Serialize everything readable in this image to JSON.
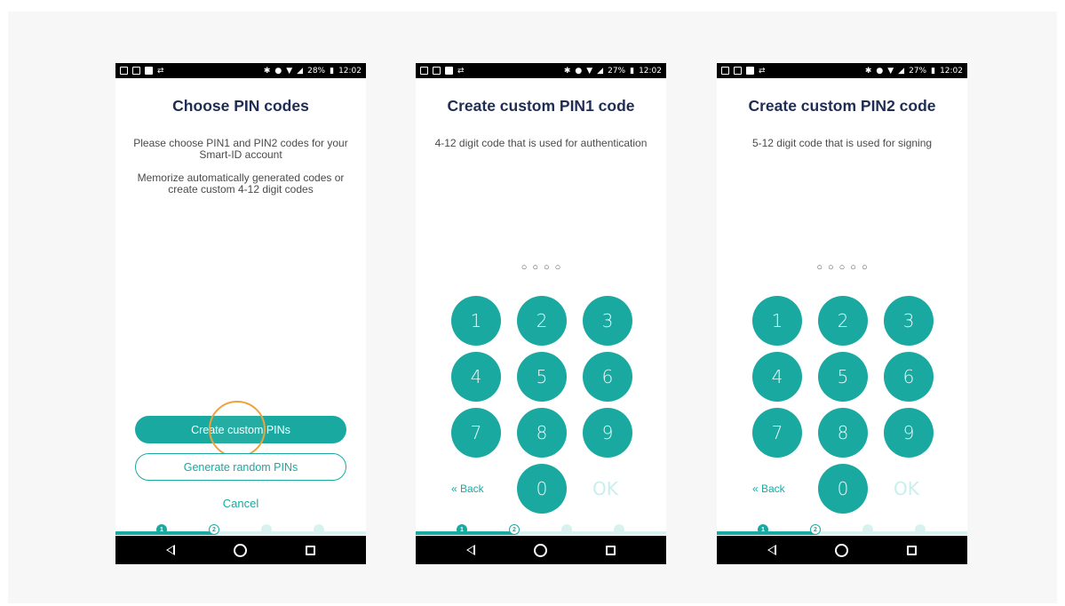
{
  "status": {
    "screen1": {
      "battery": "28%",
      "time": "12:02"
    },
    "screen2": {
      "battery": "27%",
      "time": "12:02"
    },
    "screen3": {
      "battery": "27%",
      "time": "12:02"
    }
  },
  "screen1": {
    "title": "Choose PIN codes",
    "para1": "Please choose PIN1 and PIN2 codes for your Smart-ID account",
    "para2": "Memorize automatically generated codes or create custom 4-12 digit codes",
    "create_button": "Create custom PINs",
    "generate_button": "Generate random PINs",
    "cancel": "Cancel"
  },
  "screen2": {
    "title": "Create custom PIN1 code",
    "description": "4-12 digit code that is used for authentication",
    "pin_dots": "○○○○"
  },
  "screen3": {
    "title": "Create custom PIN2 code",
    "description": "5-12 digit code that is used for signing",
    "pin_dots": "○○○○○"
  },
  "keypad": {
    "keys": [
      "1",
      "2",
      "3",
      "4",
      "5",
      "6",
      "7",
      "8",
      "9"
    ],
    "zero": "0",
    "back": "« Back",
    "ok": "OK"
  },
  "progress": {
    "steps": [
      "1",
      "2",
      "3",
      "4"
    ],
    "current": 2
  },
  "colors": {
    "accent": "#1aa9a0",
    "title": "#1f2d55",
    "highlight": "#f0a23a"
  },
  "icons": {
    "nav_back": "triangle-back-icon",
    "nav_home": "circle-home-icon",
    "nav_recent": "square-recents-icon"
  }
}
